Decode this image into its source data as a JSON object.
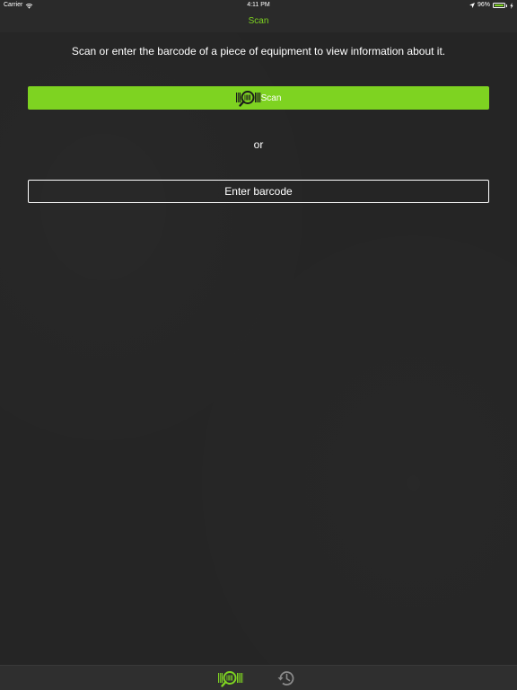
{
  "status_bar": {
    "carrier": "Carrier",
    "time": "4:11 PM",
    "battery_percent": "96%",
    "battery_level": 0.96,
    "icons": [
      "wifi-icon",
      "location-icon",
      "battery-icon",
      "charge-icon"
    ]
  },
  "nav": {
    "title": "Scan"
  },
  "main": {
    "instructions": "Scan or enter the barcode of a piece of equipment to view information about it.",
    "scan_button_label": "Scan",
    "or_label": "or",
    "enter_button_label": "Enter barcode"
  },
  "tab_bar": {
    "tabs": [
      {
        "icon": "barcode-scan-icon",
        "active": true
      },
      {
        "icon": "history-icon",
        "active": false
      }
    ]
  },
  "colors": {
    "accent": "#7ed321",
    "background": "#252525",
    "bar": "#2a2a2a",
    "tab_inactive": "#8a8a8a"
  }
}
